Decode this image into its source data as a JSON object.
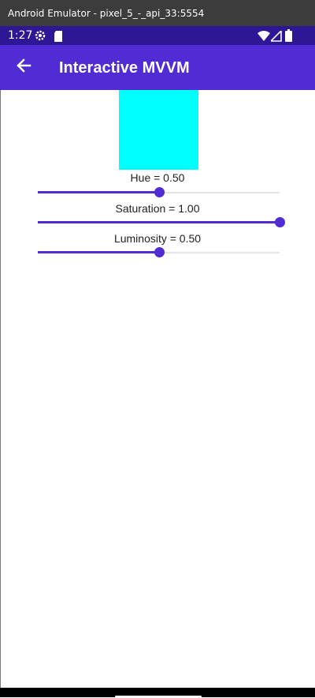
{
  "window": {
    "title": "Android Emulator - pixel_5_-_api_33:5554"
  },
  "status_bar": {
    "time": "1:27",
    "icons": [
      "settings-gear-icon",
      "sd-card-icon",
      "wifi-icon",
      "signal-icon",
      "battery-icon"
    ]
  },
  "app_bar": {
    "title": "Interactive MVVM",
    "back_icon": "arrow-left-icon"
  },
  "color_preview": {
    "color": "#00ffff"
  },
  "sliders": [
    {
      "label": "Hue = 0.50",
      "value": 0.5
    },
    {
      "label": "Saturation = 1.00",
      "value": 1.0
    },
    {
      "label": "Luminosity = 0.50",
      "value": 0.5
    }
  ],
  "colors": {
    "accent": "#512bd4",
    "status_bar": "#2e1795",
    "window_titlebar": "#3c3c3c"
  }
}
